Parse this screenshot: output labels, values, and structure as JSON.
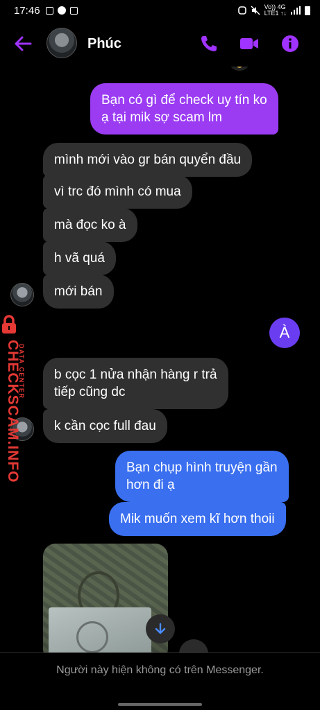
{
  "status_bar": {
    "time": "17:46",
    "network_top": "Vo)) 4G",
    "network_bottom": "LTE1 ↑↓"
  },
  "header": {
    "contact_name": "Phúc",
    "accent_color": "#a033ff"
  },
  "messages": [
    {
      "side": "out",
      "color": "purple",
      "text": "Bạn có gì để check uy tín ko\nạ tại mik sợ scam lm"
    },
    {
      "side": "in",
      "text": "mình mới vào gr bán quyển đầu"
    },
    {
      "side": "in",
      "text": "vì trc đó mình có mua"
    },
    {
      "side": "in",
      "text": "mà đọc ko à"
    },
    {
      "side": "in",
      "text": "h vã quá"
    },
    {
      "side": "in",
      "text": "mới bán"
    },
    {
      "side": "out",
      "color": "purple",
      "text": "À"
    },
    {
      "side": "in",
      "text": "b cọc 1 nửa nhận hàng r trả\ntiếp cũng dc"
    },
    {
      "side": "in",
      "text": "k cần cọc full đau"
    },
    {
      "side": "out",
      "color": "blue",
      "text": "Bạn chụp hình truyện gần\nhơn đi ạ"
    },
    {
      "side": "out",
      "color": "blue",
      "text": "Mik muốn xem kĩ hơn thoii"
    }
  ],
  "watermark": {
    "main": "CHECKSCAM.INFO",
    "sub": "DATA CENTER",
    "color": "#e53935"
  },
  "footer": {
    "notice": "Người này hiện không có trên Messenger."
  },
  "colors": {
    "purple_bubble": "#9b3cf3",
    "blue_bubble": "#3a6ff0",
    "incoming_bubble": "#303030"
  }
}
